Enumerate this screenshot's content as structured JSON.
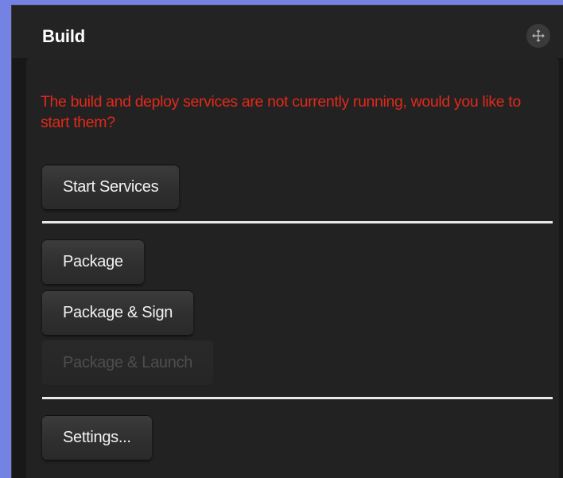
{
  "panel": {
    "title": "Build",
    "move_icon": "move-icon"
  },
  "warning": {
    "message": "The build and deploy services are not currently running, would you like to start them?",
    "color": "#e2291a"
  },
  "buttons": {
    "start_services": "Start Services",
    "package": "Package",
    "package_sign": "Package & Sign",
    "package_launch": "Package & Launch",
    "settings": "Settings..."
  },
  "theme": {
    "frame_border": "#7482e4",
    "panel_background": "#222222",
    "divider": "#e8e8e8"
  }
}
